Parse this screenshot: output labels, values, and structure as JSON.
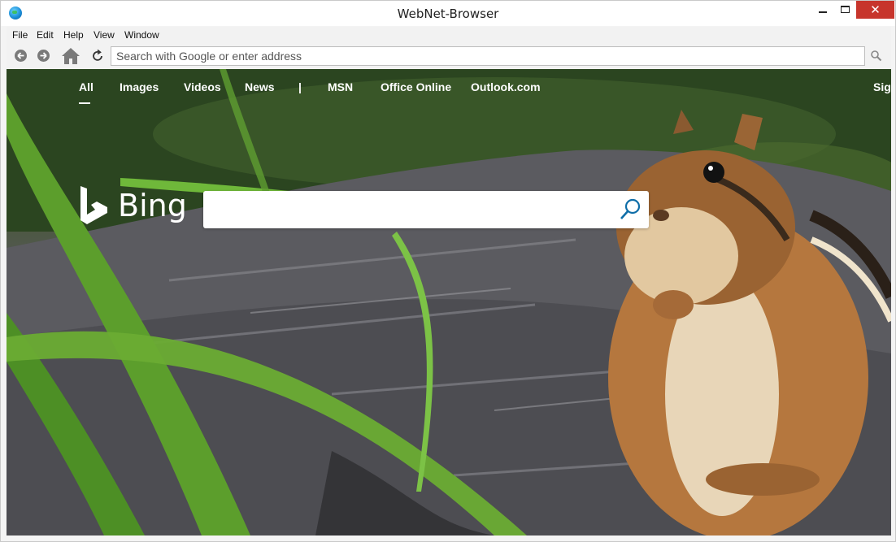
{
  "window": {
    "title": "WebNet-Browser",
    "close_glyph": "✕"
  },
  "menu": {
    "items": [
      "File",
      "Edit",
      "Help",
      "View",
      "Window"
    ]
  },
  "navbar": {
    "address_placeholder": "Search with Google or enter address"
  },
  "bing": {
    "nav_items": [
      "All",
      "Images",
      "Videos",
      "News",
      "|",
      "MSN",
      "Office Online",
      "Outlook.com"
    ],
    "signin_partial": "Sign",
    "logo_text": "Bing"
  },
  "colors": {
    "close_button": "#c7352c",
    "search_icon": "#0f6ea8",
    "bing_text": "#ffffff"
  }
}
